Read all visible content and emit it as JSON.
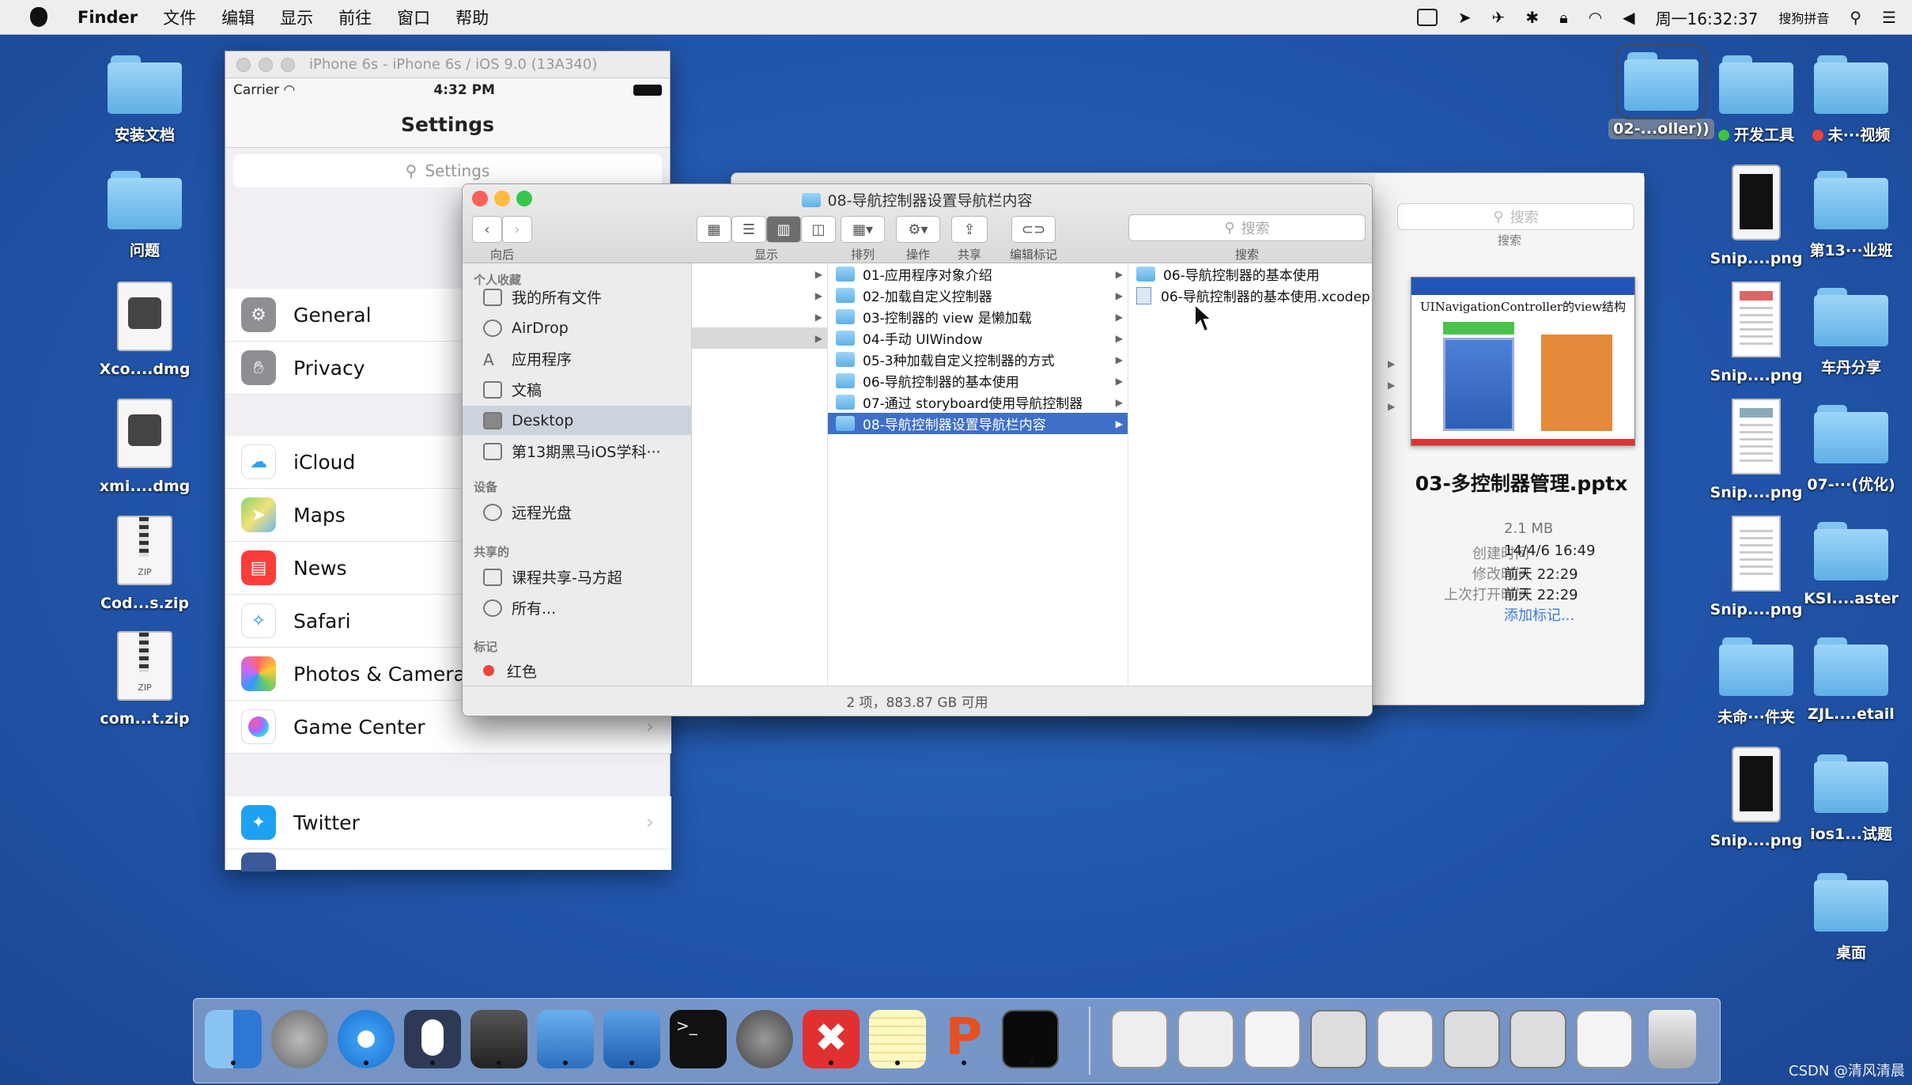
{
  "menubar": {
    "app": "Finder",
    "items": [
      "文件",
      "编辑",
      "显示",
      "前往",
      "窗口",
      "帮助"
    ],
    "clock": "周一16:32:37",
    "ime": "搜狗拼音"
  },
  "desktop_left": [
    "安装文档",
    "问题",
    "Xco....dmg",
    "xmi....dmg",
    "Cod...s.zip",
    "com...t.zip"
  ],
  "desktop_right": {
    "top": [
      "02-...oller))",
      "开发工具",
      "未···视频"
    ],
    "col1": [
      "Snip....png",
      "Snip....png",
      "Snip....png",
      "Snip....png",
      "未命···件夹",
      "Snip....png"
    ],
    "col2": [
      "第13···业班",
      "车丹分享",
      "07-···(优化)",
      "KSI....aster",
      "ZJL....etail",
      "ios1...试题",
      "桌面"
    ]
  },
  "simulator": {
    "title": "iPhone 6s - iPhone 6s / iOS 9.0 (13A340)",
    "carrier": "Carrier",
    "time": "4:32 PM",
    "nav_title": "Settings",
    "search_placeholder": "Settings",
    "rows": [
      "General",
      "Privacy",
      "iCloud",
      "Maps",
      "News",
      "Safari",
      "Photos & Camera",
      "Game Center",
      "Twitter"
    ]
  },
  "quicklook": {
    "search": "搜索",
    "search_caption": "搜索",
    "preview_title": "UINavigationController的view结构",
    "filename": "03-多控制器管理.pptx",
    "size": "2.1 MB",
    "meta": [
      {
        "k": "创建时间",
        "v": "14/4/6 16:49"
      },
      {
        "k": "修改时间",
        "v": "前天 22:29"
      },
      {
        "k": "上次打开时间",
        "v": "前天 22:29"
      }
    ],
    "add_tag": "添加标记..."
  },
  "finder": {
    "title": "08-导航控制器设置导航栏内容",
    "toolbar_captions": {
      "nav": "向后",
      "view": "显示",
      "arrange": "排列",
      "action": "操作",
      "share": "共享",
      "tags": "编辑标记",
      "search": "搜索"
    },
    "search_placeholder": "搜索",
    "sidebar": {
      "favorites_header": "个人收藏",
      "favorites": [
        "我的所有文件",
        "AirDrop",
        "应用程序",
        "文稿",
        "Desktop",
        "第13期黑马iOS学科···"
      ],
      "devices_header": "设备",
      "devices": [
        "远程光盘"
      ],
      "shared_header": "共享的",
      "shared": [
        "课程共享-马方超",
        "所有..."
      ],
      "tags_header": "标记",
      "tags": [
        "红色"
      ]
    },
    "col2": [
      "01-应用程序对象介绍",
      "02-加载自定义控制器",
      "03-控制器的 view 是懒加载",
      "04-手动 UIWindow",
      "05-3种加载自定义控制器的方式",
      "06-导航控制器的基本使用",
      "07-通过 storyboard使用导航控制器",
      "08-导航控制器设置导航栏内容"
    ],
    "col3": [
      "06-导航控制器的基本使用",
      "06-导航控制器的基本使用.xcodep"
    ],
    "status": "2 项，883.87 GB 可用"
  },
  "watermark": "CSDN @清风清晨",
  "colors": {
    "desktop": "#2257ad",
    "selection": "#3f6fc7",
    "close": "#fc605c",
    "minimize": "#fdbc40",
    "zoom": "#34c84a"
  }
}
